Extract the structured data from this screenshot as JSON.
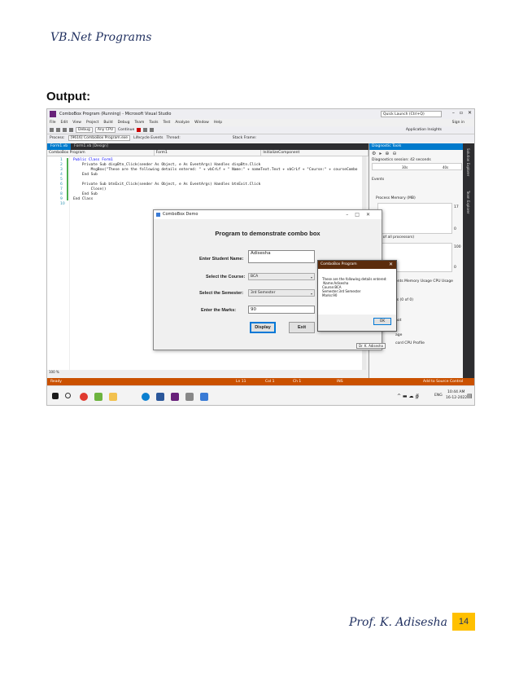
{
  "page": {
    "header": "VB.Net Programs",
    "output_label": "Output:",
    "footer_author": "Prof. K. Adisesha",
    "page_number": "14"
  },
  "vs": {
    "title": "ComboBox Program (Running) - Microsoft Visual Studio",
    "quick_launch": "Quick Launch (Ctrl+Q)",
    "sign_in": "Sign in",
    "menu": [
      "File",
      "Edit",
      "View",
      "Project",
      "Build",
      "Debug",
      "Team",
      "Tools",
      "Test",
      "Analyze",
      "Window",
      "Help"
    ],
    "toolbar_debug": "Debug",
    "toolbar_cpu": "Any CPU",
    "toolbar_continue": "Continue",
    "toolbar_app_insights": "Application Insights",
    "process_label": "Process:",
    "process_value": "[9616] ComboBox Program.exe",
    "lifecycle": "Lifecycle Events",
    "thread": "Thread:",
    "stack_frame": "Stack Frame:",
    "tabs": [
      "Form1.vb",
      "Form1.vb [Design]"
    ],
    "nav": [
      "ComboBox Program",
      "Form1",
      "InitializeComponent"
    ],
    "zoom": "100 %",
    "status": {
      "ready": "Ready",
      "ln": "Ln 11",
      "col": "Col 1",
      "ch": "Ch 1",
      "ins": "INS",
      "source": "Add to Source Control"
    },
    "tray": {
      "lang": "ENG",
      "time": "10:44 AM",
      "date": "16-12-2022"
    }
  },
  "code_lines": [
    {
      "n": "1",
      "t": "Public Class Form1"
    },
    {
      "n": "2",
      "t": "    Private Sub dispBtn_Click(sender As Object, e As EventArgs) Handles dispBtn.Click"
    },
    {
      "n": "3",
      "t": "        MsgBox(\"These are the following details entered: \" + vbCrLf + \" Name:\" + nameText.Text + vbCrLf + \"Course:\" + courseCombo"
    },
    {
      "n": "4",
      "t": "    End Sub"
    },
    {
      "n": "5",
      "t": ""
    },
    {
      "n": "6",
      "t": "    Private Sub btnExit_Click(sender As Object, e As EventArgs) Handles btnExit.Click"
    },
    {
      "n": "7",
      "t": "        Close()"
    },
    {
      "n": "8",
      "t": "    End Sub"
    },
    {
      "n": "9",
      "t": "End Class"
    },
    {
      "n": "10",
      "t": ""
    }
  ],
  "diag": {
    "title": "Diagnostic Tools",
    "session": "Diagnostics session: 42 seconds",
    "tick1": "30s",
    "tick2": "40s",
    "events": "Events",
    "memory": "Process Memory (MB)",
    "mem_val": "17",
    "mem_zero": "0",
    "cpu": "% of all processors)",
    "cpu_max": "100",
    "cpu_zero": "0",
    "tabs_text": "ents  Memory Usage  CPU Usage",
    "events_count": "ts (0 of 0)",
    "snapshot": "hot",
    "usage": "age",
    "record": "cord CPU Profile",
    "side_right": [
      "Solution Explorer",
      "Team Explorer"
    ]
  },
  "form": {
    "title": "ComboBox Demo",
    "heading": "Program to demonstrate combo box",
    "name_label": "Enter Student Name:",
    "name_value": "Adisesha",
    "course_label": "Select the Course:",
    "course_value": "BCA",
    "semester_label": "Select the Semester:",
    "semester_value": "3rd Semester",
    "marks_label": "Enter the Marks:",
    "marks_value": "90",
    "display_btn": "Display",
    "exit_btn": "Exit"
  },
  "msgbox": {
    "title": "ComboBox Program",
    "text": "These are the following details entered:\n Name:Adisesha\nCourse:BCA\nSemester:3rd Semester\nMarks:90",
    "ok": "OK"
  },
  "tooltip": "Dr. K. Adisesha",
  "colors": {
    "accent": "#007acc",
    "status": "#ca5100",
    "page_badge": "#ffc000",
    "header_text": "#1f2f5f"
  }
}
